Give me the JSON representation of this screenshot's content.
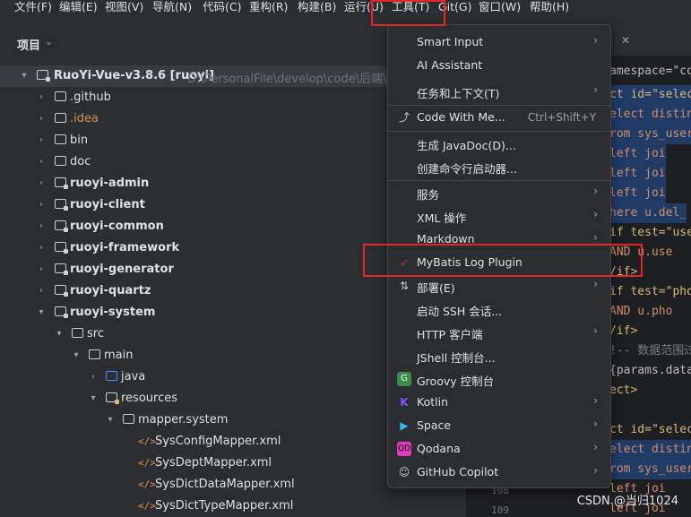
{
  "menubar": [
    "文件(F)",
    "编辑(E)",
    "视图(V)",
    "导航(N)",
    "代码(C)",
    "重构(R)",
    "构建(B)",
    "运行(U)",
    "工具(T)",
    "Git(G)",
    "窗口(W)",
    "帮助(H)"
  ],
  "project": {
    "title": "项目",
    "root": {
      "name": "RuoYi-Vue-v3.8.6 [ruoyi]",
      "path": "D:\\PersonalFile\\develop\\code\\后端\\java"
    },
    "items": [
      ".github",
      ".idea",
      "bin",
      "doc",
      "ruoyi-admin",
      "ruoyi-client",
      "ruoyi-common",
      "ruoyi-framework",
      "ruoyi-generator",
      "ruoyi-quartz",
      "ruoyi-system",
      "src",
      "main",
      "java",
      "resources",
      "mapper.system",
      "SysConfigMapper.xml",
      "SysDeptMapper.xml",
      "SysDictDataMapper.xml",
      "SysDictTypeMapper.xml"
    ]
  },
  "editor": {
    "tab_close": "✕",
    "lines": [
      "amespace=\"co",
      "ct id=\"selec",
      "elect distin",
      "rom sys_user",
      "    left joi",
      "    left joi",
      "    left joi",
      "here u.del_",
      "if test=\"use",
      "  AND u.use",
      "/if>",
      "if test=\"pho",
      "  AND u.pho",
      "/if>",
      "!-- 数据范围过",
      "{params.data",
      "ect>",
      "",
      "ct id=\"selec",
      "elect distin",
      "rom sys_user",
      "    left joi",
      "    left joi"
    ],
    "gutter": [
      "108",
      "109"
    ]
  },
  "tools_menu": {
    "items": [
      {
        "label": "Smart Input",
        "submenu": true
      },
      {
        "label": "AI Assistant"
      },
      {
        "label": "任务和上下文(T)",
        "submenu": true
      },
      {
        "label": "Code With Me...",
        "shortcut": "Ctrl+Shift+Y",
        "icon": "share-icon"
      },
      {
        "label": "生成 JavaDoc(D)..."
      },
      {
        "label": "创建命令行启动器..."
      },
      {
        "label": "服务",
        "submenu": true
      },
      {
        "label": "XML 操作",
        "submenu": true
      },
      {
        "label": "Markdown",
        "submenu": true
      },
      {
        "label": "MyBatis Log Plugin",
        "icon": "mybatis-bird-icon"
      },
      {
        "label": "部署(E)",
        "submenu": true,
        "icon": "deploy-icon"
      },
      {
        "label": "启动 SSH 会话..."
      },
      {
        "label": "HTTP 客户端",
        "submenu": true
      },
      {
        "label": "JShell 控制台..."
      },
      {
        "label": "Groovy 控制台",
        "icon": "groovy-icon"
      },
      {
        "label": "Kotlin",
        "submenu": true,
        "icon": "kotlin-icon"
      },
      {
        "label": "Space",
        "submenu": true,
        "icon": "space-icon"
      },
      {
        "label": "Qodana",
        "submenu": true,
        "icon": "qodana-icon"
      },
      {
        "label": "GitHub Copilot",
        "submenu": true,
        "icon": "copilot-icon"
      }
    ]
  },
  "watermark": "CSDN @当归1024",
  "colors": {
    "highlight_box": "#e5252a",
    "background": "#2b2d30",
    "editor_bg": "#1e1f22"
  }
}
